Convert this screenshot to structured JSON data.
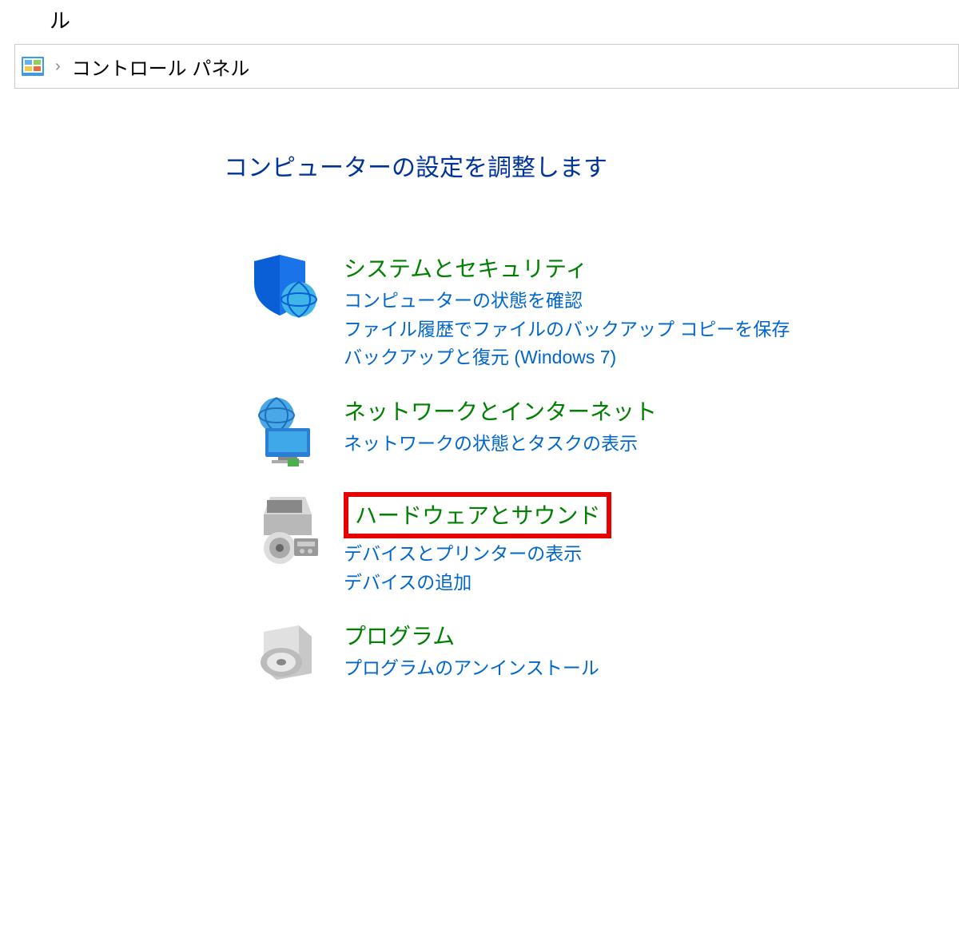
{
  "window": {
    "title_fragment": "ル"
  },
  "breadcrumb": {
    "location": "コントロール パネル"
  },
  "heading": "コンピューターの設定を調整します",
  "categories": [
    {
      "icon": "shield-icon",
      "title": "システムとセキュリティ",
      "links": [
        "コンピューターの状態を確認",
        "ファイル履歴でファイルのバックアップ コピーを保存",
        "バックアップと復元 (Windows 7)"
      ]
    },
    {
      "icon": "network-icon",
      "title": "ネットワークとインターネット",
      "links": [
        "ネットワークの状態とタスクの表示"
      ]
    },
    {
      "icon": "hardware-icon",
      "title": "ハードウェアとサウンド",
      "links": [
        "デバイスとプリンターの表示",
        "デバイスの追加"
      ],
      "highlighted": true
    },
    {
      "icon": "programs-icon",
      "title": "プログラム",
      "links": [
        "プログラムのアンインストール"
      ]
    }
  ]
}
